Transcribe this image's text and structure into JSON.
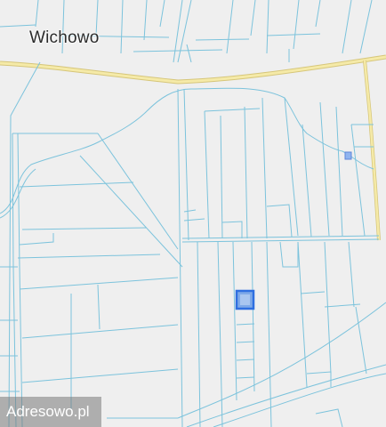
{
  "map": {
    "place_label": "Wichowo",
    "watermark": "Adresowo.pl",
    "colors": {
      "background": "#efefef",
      "parcel_line": "#7cc3dc",
      "main_road": "#f3e59a",
      "road_edge": "#d6c67a",
      "highlight_fill": "#6ea0e6",
      "highlight_stroke": "#2f6fe0"
    },
    "icons": [
      "map-marker-icon"
    ]
  }
}
